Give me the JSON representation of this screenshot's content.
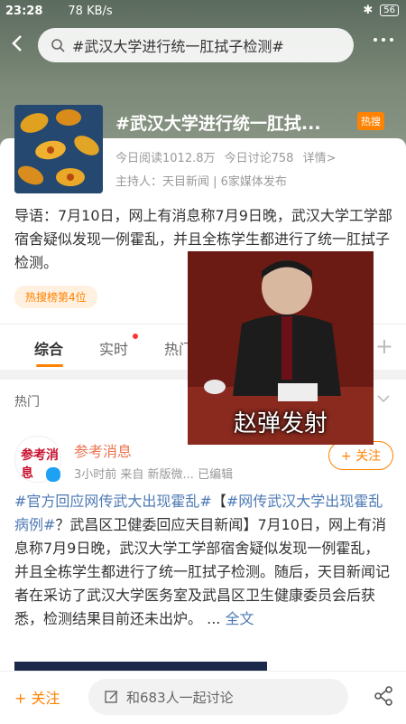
{
  "status_bar": {
    "time": "23:28",
    "network_speed": "78 KB/s",
    "battery": "56"
  },
  "search": {
    "query": "#武汉大学进行统一肛拭子检测#"
  },
  "topic": {
    "title": "#武汉大学进行统一肛拭...",
    "hot_tag": "热搜",
    "reads": "今日阅读1012.8万",
    "discussions": "今日讨论758",
    "details_link": "详情>",
    "host": "主持人：天目新闻 | 6家媒体发布",
    "intro": "导语：7月10日，网上有消息称7月9日晚，武汉大学工学部宿舍疑似发现一例霍乱，并且全栋学生都进行了统一肛拭子检测。",
    "rank_badge": "热搜榜第4位"
  },
  "tabs": [
    {
      "label": "综合",
      "active": true
    },
    {
      "label": "实时",
      "active": false
    },
    {
      "label": "热门",
      "active": false
    }
  ],
  "section": {
    "label": "热门"
  },
  "post": {
    "author": "参考消息",
    "meta": "3小时前  来自 新版微... 已编辑",
    "follow_label": "+ 关注",
    "hashtag1": "#官方回应网传武大出现霍乱#",
    "bracket_open": "【",
    "hashtag2": "#网传武汉大学出现霍乱病例#",
    "lead": "？武昌区卫健委回应天目新闻】",
    "text": "7月10日，网上有消息称7月9日晚，武汉大学工学部宿舍疑似发现一例霍乱，并且全栋学生都进行了统一肛拭子检测。随后，天目新闻记者在采访了武汉大学医务室及武昌区卫生健康委员会后获悉，检测结果目前还未出炉。",
    "ellipsis": "...",
    "full_text_link": "全文",
    "avatar_text": "参考消息"
  },
  "overlay": {
    "caption": "赵弹发射"
  },
  "bottom_bar": {
    "follow_label": "+ 关注",
    "discussion_placeholder": "和683人一起讨论"
  },
  "colors": {
    "accent": "#ff8200",
    "link": "#4e7ab5",
    "author": "#eb7350"
  }
}
